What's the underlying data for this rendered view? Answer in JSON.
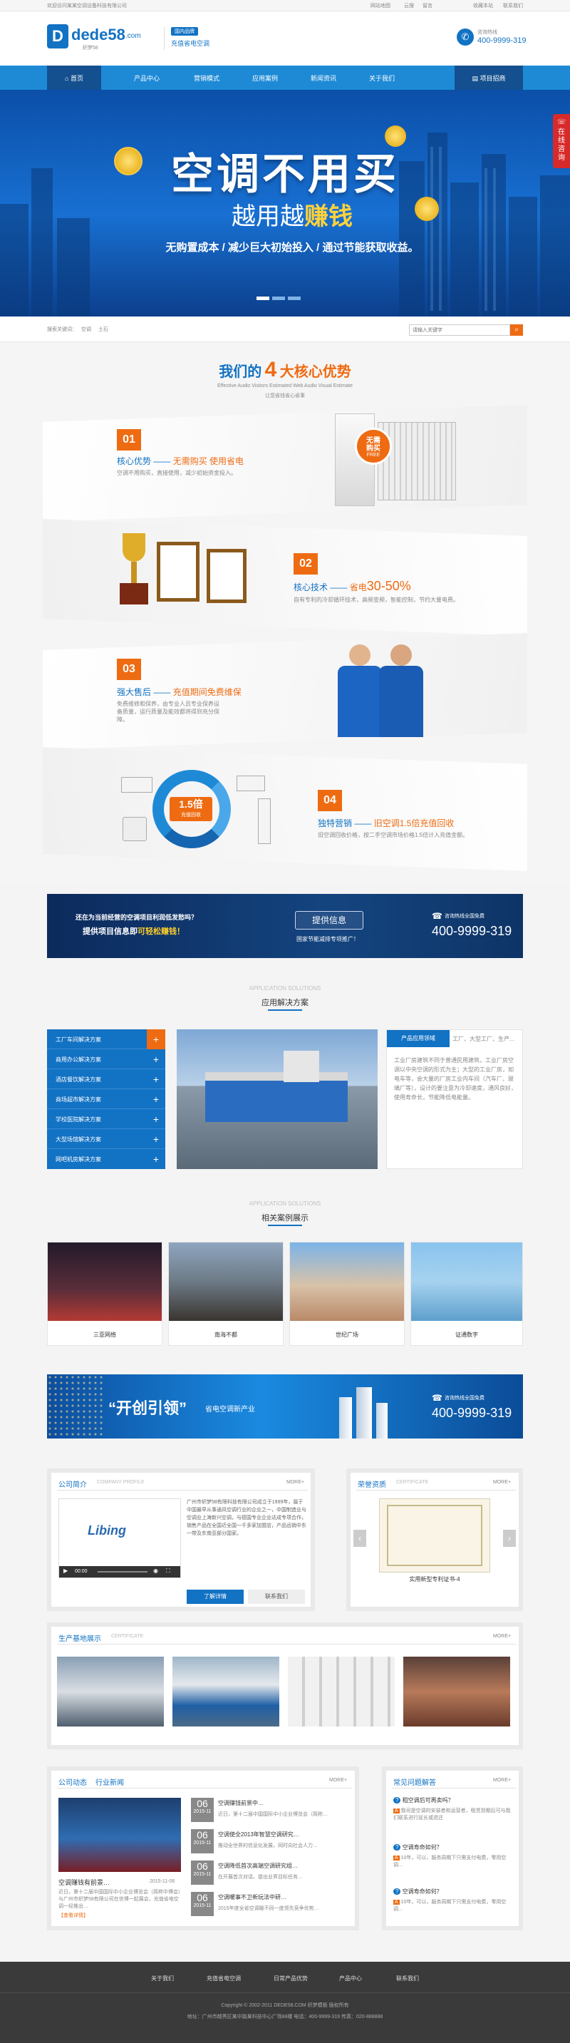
{
  "topbar": {
    "welcome": "欢迎访问某某空调设备科技有限公司",
    "links": [
      "网站地图",
      "云搜",
      "留言"
    ],
    "right_links": [
      "收藏本站",
      "联系我们"
    ]
  },
  "header": {
    "logo": "dede58",
    "logo_tld": ".com",
    "logo_sub": "织梦58",
    "badge": "国内品牌",
    "slogan": "充值省电空调",
    "hotline_label": "咨询热线",
    "hotline": "400-9999-319"
  },
  "nav": {
    "items": [
      "首页",
      "产品中心",
      "营销模式",
      "应用案例",
      "新闻资讯",
      "关于我们"
    ],
    "right": "项目招商",
    "active": 0
  },
  "banner": {
    "title": "空调不用买",
    "sub1": "越用越",
    "sub2": "赚钱",
    "tagline": "无购置成本 / 减少巨大初始投入 / 通过节能获取收益。",
    "float": "在线咨询"
  },
  "search": {
    "label": "搜索关键词：",
    "hot": [
      "空调",
      "土石"
    ],
    "placeholder": "请输入关键字"
  },
  "adv": {
    "title_a": "我们的",
    "title_num": "4",
    "title_b": "大核心优势",
    "sub": "Effective Audio Visitors Estimated Web Audio Visual Estimate",
    "sub2": "让您省钱省心省事",
    "items": [
      {
        "num": "01",
        "title_a": "核心优势 ——",
        "title_b": "无需购买 使用省电",
        "desc": "空调不用购买，直接使用，减少初始资金投入。",
        "stamp": "无需购买",
        "stamp_sub": "FREE"
      },
      {
        "num": "02",
        "title_a": "核心技术 ——",
        "title_b": "省电",
        "title_c": "30-50%",
        "desc": "自有专利的冷却循环技术，高频变频，智能控制，节约大量电费。"
      },
      {
        "num": "03",
        "title_a": "强大售后 ——",
        "title_b": "充值期间免费维保",
        "desc": "免费维修和保养，由专业人员专业保养设备质量，运行质量及能效都将得到充分保障。"
      },
      {
        "num": "04",
        "title_a": "独特营销 ——",
        "title_b": "旧空调1.5倍充值回收",
        "desc": "旧空调回收价格，按二手空调市场价格1.5倍计入充值金额。",
        "badge": "1.5倍",
        "badge_sub": "充值回收"
      }
    ]
  },
  "cta1": {
    "l1": "还在为当前经营的空调项目利润低发愁吗？",
    "l2a": "提供项目信息即",
    "l2b": "可轻松赚钱！",
    "btn": "提供信息",
    "note": "国家节能减排专项推广！",
    "hotline_label": "咨询热线全国免费",
    "hotline": "400-9999-319"
  },
  "solutions": {
    "en": "APPLICATION SOLUTIONS",
    "title": "应用解决方案",
    "list": [
      "工厂车间解决方案",
      "商用办公解决方案",
      "酒店餐饮解决方案",
      "商场超市解决方案",
      "学校医院解决方案",
      "大型场馆解决方案",
      "网吧机房解决方案"
    ],
    "tab_active": "产品应用领域",
    "tab2": "工厂、大型工厂、生产...",
    "desc": "工业厂房建筑不同于普通民用建筑，工业厂房空调以中央空调的形式为主；大型的工业厂房，如电车等，会大量的厂房工业内车间（汽车厂、玻璃厂等），设计的要注意为冷却速度，通风良好，使用寿命长，节能降低电能量。"
  },
  "cases": {
    "en": "APPLICATION SOLUTIONS",
    "title": "相关案例展示",
    "items": [
      "三亚网络",
      "南海不都",
      "世纪广场",
      "证通数字"
    ]
  },
  "cta2": {
    "quote": "“开创引领”",
    "text": "省电空调新产业",
    "hotline_label": "咨询热线全国免费",
    "hotline": "400-9999-319"
  },
  "company": {
    "title": "公司简介",
    "en": "COMPANY PROFILE",
    "more": "MORE+",
    "text": "广州市织梦58有限科技有限公司成立于1999年，属于中国最早从事通风空调行业的企业之一，中国制造业与空调业上海新兴空调，与德国专业企业达成专项合作，销售产品在全国近全国一千多家加盟店，产品远销中东一带及东南亚部分国家。",
    "btn1": "了解详情",
    "btn2": "联系我们",
    "video_logo": "Libing",
    "video_time": "00:00"
  },
  "honor": {
    "title": "荣誉资质",
    "en": "CERTIFICATE",
    "more": "MORE+",
    "caption": "实用新型专利证书-4"
  },
  "production": {
    "title": "生产基地展示",
    "en": "CERTIFICATE",
    "more": "MORE+"
  },
  "news": {
    "tabs": [
      "公司动态",
      "行业新闻"
    ],
    "more": "MORE+",
    "feature_title": "空调赚钱有前景…",
    "feature_date": "2015-11-06",
    "feature_desc": "近日，第十二届中国国际中小企业博览会（简称中博会）与广州市织梦58有限公司在世博一起展会，充值省电空调一经推出…",
    "more_link": "【查看详情】",
    "items": [
      {
        "day": "06",
        "ym": "2015-11",
        "title": "空调赚钱前景中…",
        "desc": "近日，第十二届中国国际中小企业博览会（简称…"
      },
      {
        "day": "06",
        "ym": "2015-11",
        "title": "空调使全2013年智慧空调研究…",
        "desc": "推动全世界的信息化发展，同时向社会人力…"
      },
      {
        "day": "06",
        "ym": "2015-11",
        "title": "空调降低首次高端空调研究组…",
        "desc": "在开展首次对话，提出业界目标任务…"
      },
      {
        "day": "06",
        "ym": "2015-11",
        "title": "空调暖事不卫新玩法中研…",
        "desc": "2015年度全省空调暖不同一度领先竞争优势…"
      }
    ]
  },
  "faq": {
    "title": "常见问题解答",
    "more": "MORE+",
    "items": [
      {
        "q": "租空调后可再卖吗？",
        "a": "我司是空调的安装者和运营者，租赁到期后可与我们联系进行延长或退还"
      },
      {
        "q": "空调寿命如何？",
        "a": "10年，可以，服务周期下只需支付电费，零用空调..."
      },
      {
        "q": "空调寿命如何？",
        "a": "10年，可以，服务周期下只需支付电费，零用空调..."
      }
    ]
  },
  "footer": {
    "links": [
      "关于我们",
      "充值省电空调",
      "日常产品优势",
      "产品中心",
      "联系我们"
    ],
    "copyright": "Copyright © 2002-2011 DEDE58.COM 织梦模板 版权所有",
    "address": "地址：广州市越秀区某中路某科技中心广场88楼  电话：400-9999-319  传真：020-888888"
  },
  "colors": {
    "brand": "#1272c4",
    "accent": "#ee6b12",
    "dark": "#1f4e85"
  }
}
